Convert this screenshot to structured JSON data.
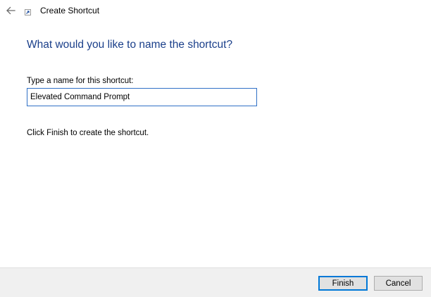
{
  "window": {
    "title": "Create Shortcut"
  },
  "icons": {
    "back": "back-arrow-icon",
    "app": "shortcut-icon"
  },
  "colors": {
    "heading": "#1a3f8a",
    "input_border": "#2f70c6",
    "default_button_border": "#0078d7",
    "footer_background": "#f0f0f0"
  },
  "content": {
    "heading": "What would you like to name the shortcut?",
    "field_label": "Type a name for this shortcut:",
    "name_value": "Elevated Command Prompt",
    "hint": "Click Finish to create the shortcut."
  },
  "footer": {
    "finish_label": "Finish",
    "cancel_label": "Cancel"
  }
}
